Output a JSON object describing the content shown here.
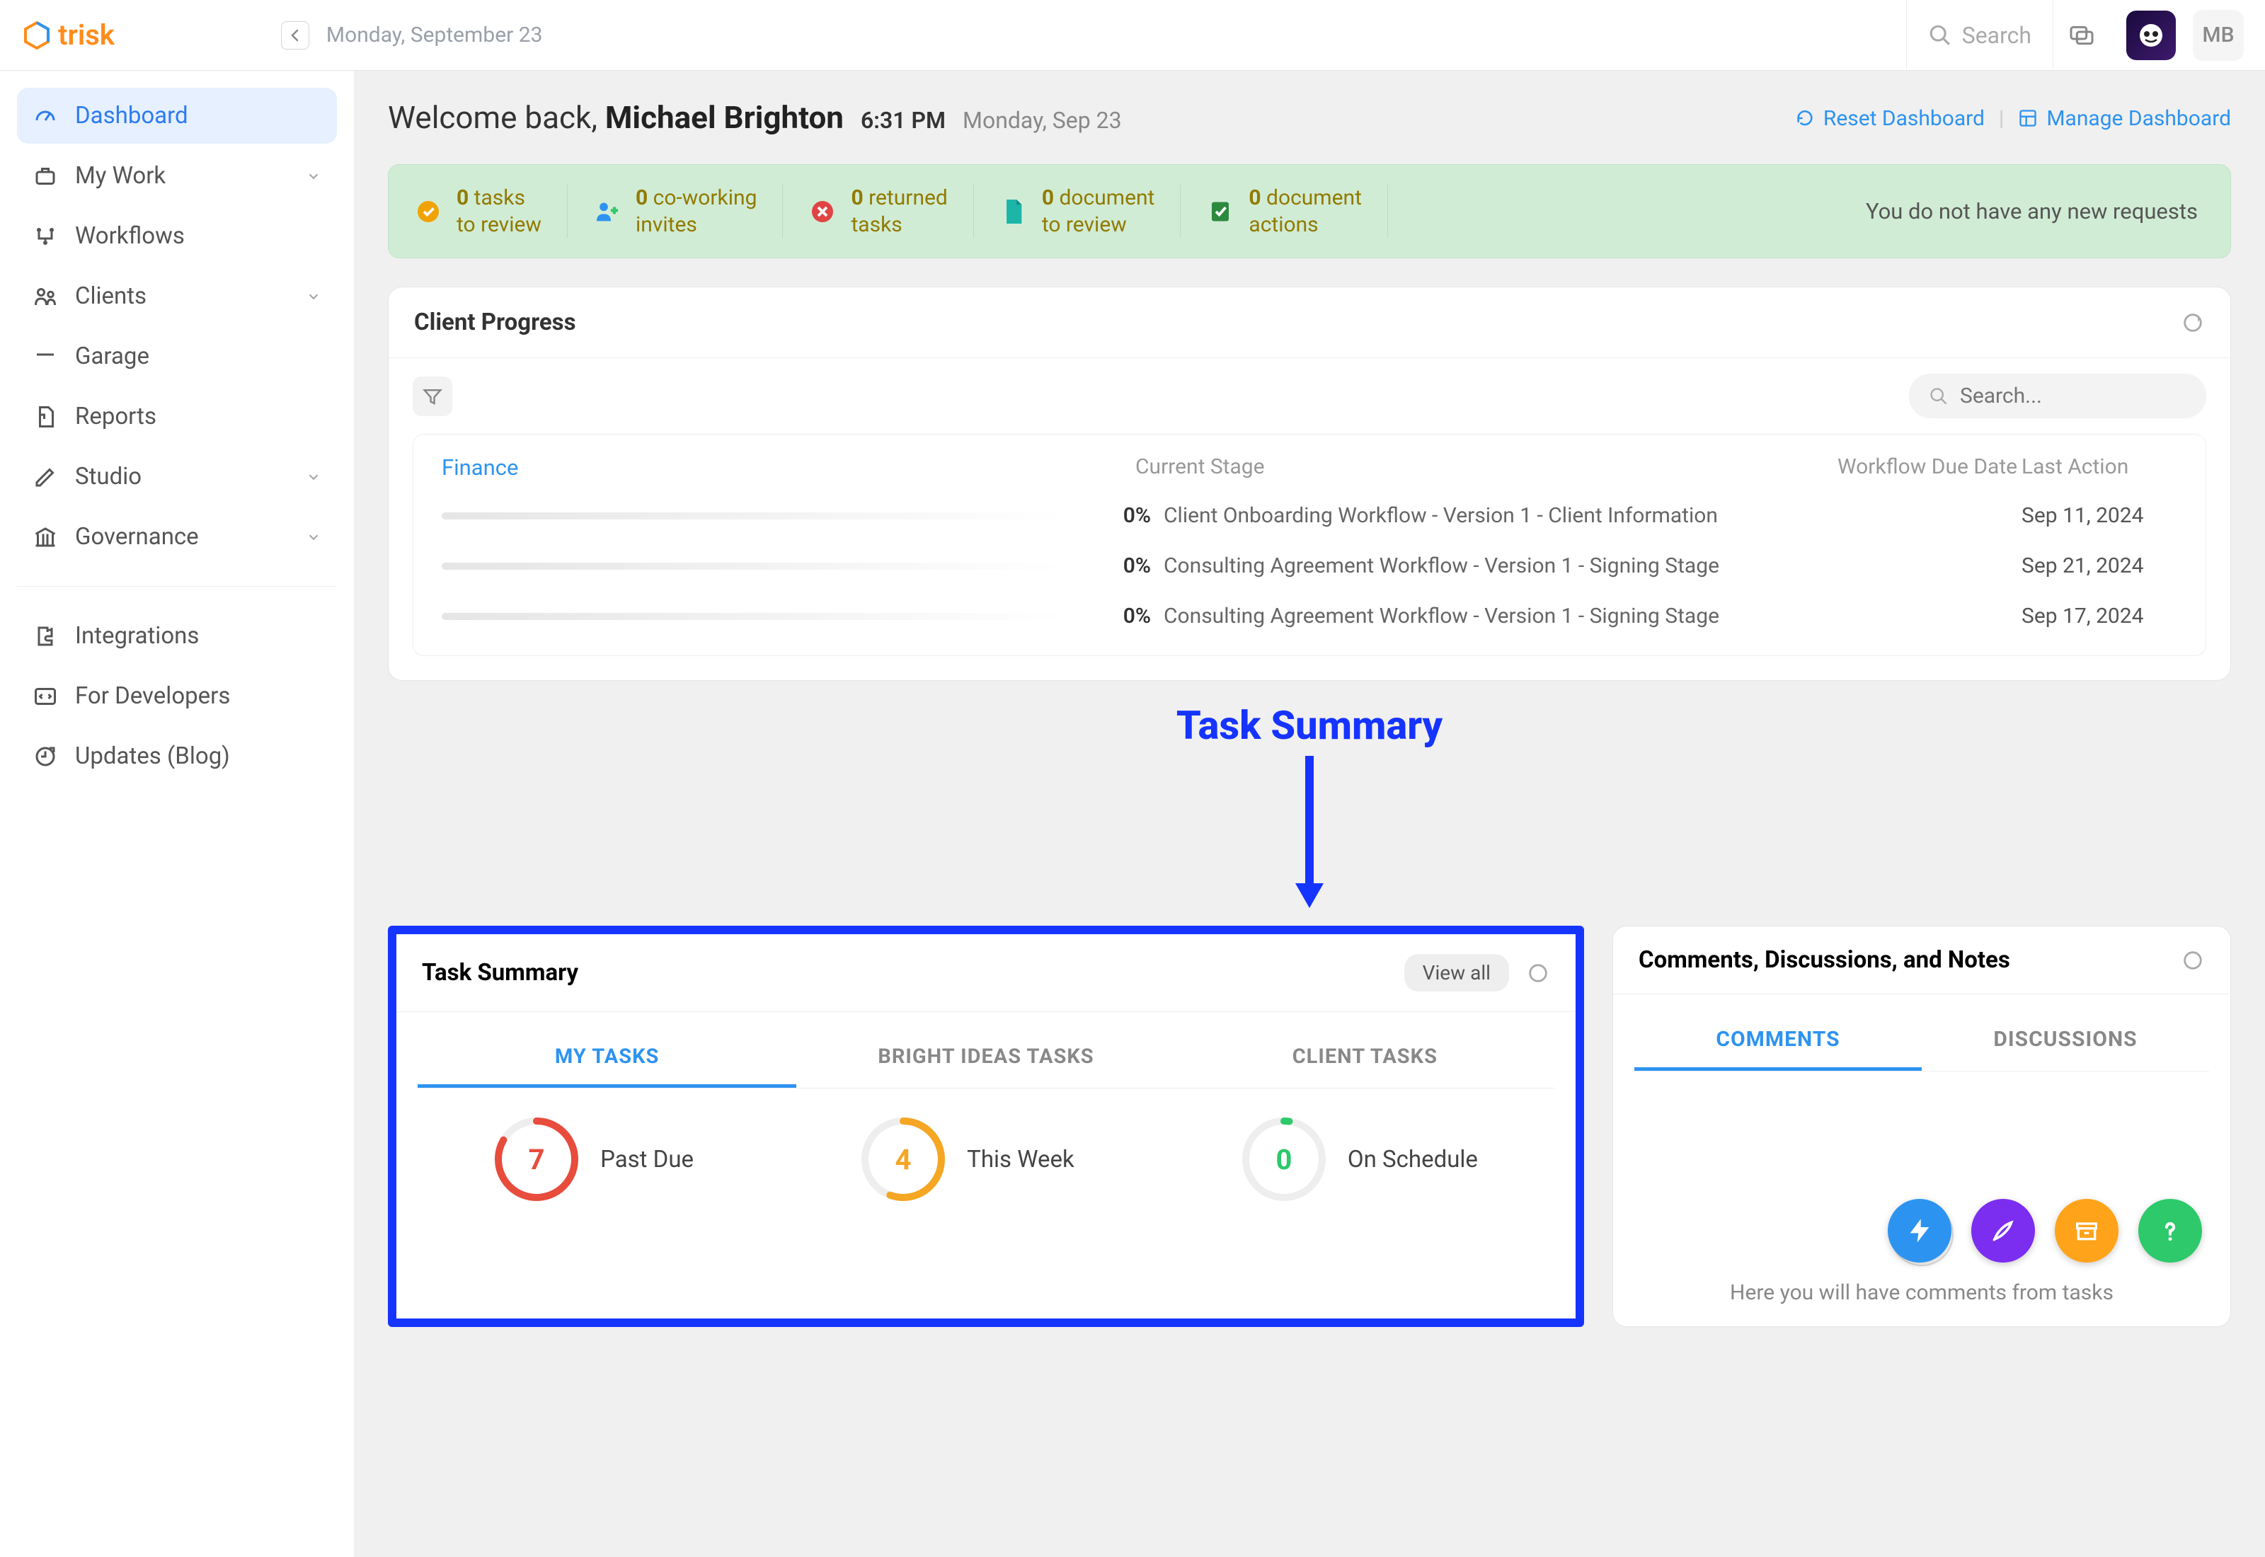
{
  "brand": {
    "name": "trisk"
  },
  "topbar": {
    "date": "Monday, September 23",
    "search_placeholder": "Search",
    "user_initials": "MB"
  },
  "sidebar": {
    "items": [
      {
        "label": "Dashboard",
        "active": true,
        "icon": "speedometer",
        "expandable": false
      },
      {
        "label": "My Work",
        "active": false,
        "icon": "briefcase",
        "expandable": true
      },
      {
        "label": "Workflows",
        "active": false,
        "icon": "flow",
        "expandable": false
      },
      {
        "label": "Clients",
        "active": false,
        "icon": "people",
        "expandable": true
      },
      {
        "label": "Garage",
        "active": false,
        "icon": "garage",
        "expandable": false
      },
      {
        "label": "Reports",
        "active": false,
        "icon": "report",
        "expandable": false
      },
      {
        "label": "Studio",
        "active": false,
        "icon": "pencil",
        "expandable": true
      },
      {
        "label": "Governance",
        "active": false,
        "icon": "bank",
        "expandable": true
      }
    ],
    "secondary": [
      {
        "label": "Integrations",
        "icon": "puzzle"
      },
      {
        "label": "For Developers",
        "icon": "code"
      },
      {
        "label": "Updates (Blog)",
        "icon": "update"
      }
    ]
  },
  "welcome": {
    "prefix": "Welcome back, ",
    "name": "Michael Brighton",
    "time": "6:31 PM",
    "daydate": "Monday, Sep 23",
    "reset_label": "Reset Dashboard",
    "manage_label": "Manage Dashboard",
    "separator": "|"
  },
  "banner": {
    "cells": [
      {
        "count": "0",
        "line1": "tasks",
        "line2": "to review",
        "color": "#f0a300",
        "icon": "check-circle"
      },
      {
        "count": "0",
        "line1": "co-working",
        "line2": "invites",
        "color": "#2d93f0",
        "icon": "user-plus"
      },
      {
        "count": "0",
        "line1": "returned",
        "line2": "tasks",
        "color": "#e04444",
        "icon": "x-circle"
      },
      {
        "count": "0",
        "line1": "document",
        "line2": "to review",
        "color": "#1aa37a",
        "icon": "doc"
      },
      {
        "count": "0",
        "line1": "document",
        "line2": "actions",
        "color": "#2b8a3e",
        "icon": "doc-check"
      }
    ],
    "right_msg": "You do not have any new requests"
  },
  "client_progress": {
    "title": "Client Progress",
    "search_placeholder": "Search...",
    "category_label": "Finance",
    "columns": {
      "stage": "Current Stage",
      "due": "Workflow Due Date",
      "last": "Last Action"
    },
    "rows": [
      {
        "pct": "0%",
        "stage": "Client Onboarding Workflow - Version 1 - Client Information",
        "due": "",
        "last": "Sep 11, 2024"
      },
      {
        "pct": "0%",
        "stage": "Consulting Agreement Workflow - Version 1 - Signing Stage",
        "due": "",
        "last": "Sep 21, 2024"
      },
      {
        "pct": "0%",
        "stage": "Consulting Agreement Workflow - Version 1 - Signing Stage",
        "due": "",
        "last": "Sep 17, 2024"
      }
    ]
  },
  "annotation": {
    "label": "Task Summary"
  },
  "task_summary": {
    "title": "Task Summary",
    "view_all": "View all",
    "tabs": [
      {
        "label": "MY TASKS",
        "active": true
      },
      {
        "label": "BRIGHT IDEAS TASKS",
        "active": false
      },
      {
        "label": "CLIENT TASKS",
        "active": false
      }
    ],
    "stats": [
      {
        "value": "7",
        "label": "Past Due",
        "color": "#e74c3c",
        "sweep": 300
      },
      {
        "value": "4",
        "label": "This Week",
        "color": "#f5a623",
        "sweep": 200
      },
      {
        "value": "0",
        "label": "On Schedule",
        "color": "#2dc96a",
        "sweep": 8
      }
    ]
  },
  "comments": {
    "title": "Comments, Discussions, and Notes",
    "tabs": [
      {
        "label": "COMMENTS",
        "active": true
      },
      {
        "label": "DISCUSSIONS",
        "active": false
      }
    ],
    "empty_text": "Here you will have comments from tasks"
  }
}
